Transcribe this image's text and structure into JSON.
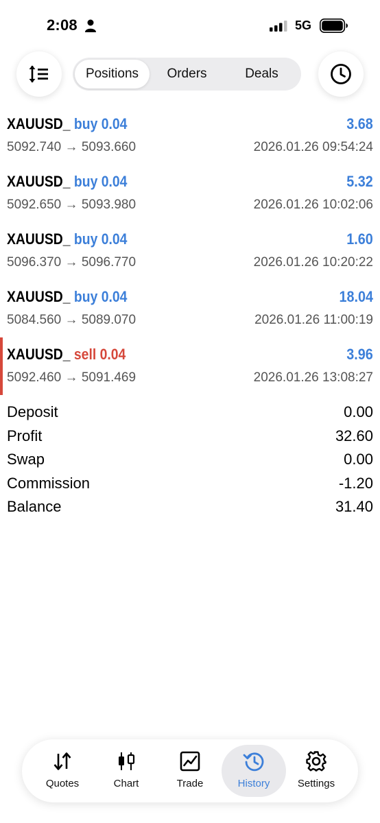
{
  "status": {
    "time": "2:08",
    "network": "5G"
  },
  "toolbar": {
    "tabs": [
      "Positions",
      "Orders",
      "Deals"
    ],
    "active_tab": "Positions"
  },
  "trades": [
    {
      "symbol": "XAUUSD_",
      "side": "buy",
      "volume": "0.04",
      "profit": "3.68",
      "open": "5092.740",
      "close": "5093.660",
      "time": "2026.01.26 09:54:24"
    },
    {
      "symbol": "XAUUSD_",
      "side": "buy",
      "volume": "0.04",
      "profit": "5.32",
      "open": "5092.650",
      "close": "5093.980",
      "time": "2026.01.26 10:02:06"
    },
    {
      "symbol": "XAUUSD_",
      "side": "buy",
      "volume": "0.04",
      "profit": "1.60",
      "open": "5096.370",
      "close": "5096.770",
      "time": "2026.01.26 10:20:22"
    },
    {
      "symbol": "XAUUSD_",
      "side": "buy",
      "volume": "0.04",
      "profit": "18.04",
      "open": "5084.560",
      "close": "5089.070",
      "time": "2026.01.26 11:00:19"
    },
    {
      "symbol": "XAUUSD_",
      "side": "sell",
      "volume": "0.04",
      "profit": "3.96",
      "open": "5092.460",
      "close": "5091.469",
      "time": "2026.01.26 13:08:27"
    }
  ],
  "summary": [
    {
      "label": "Deposit",
      "value": "0.00"
    },
    {
      "label": "Profit",
      "value": "32.60"
    },
    {
      "label": "Swap",
      "value": "0.00"
    },
    {
      "label": "Commission",
      "value": "-1.20"
    },
    {
      "label": "Balance",
      "value": "31.40"
    }
  ],
  "tabbar": [
    {
      "label": "Quotes",
      "icon": "quotes-arrows-icon"
    },
    {
      "label": "Chart",
      "icon": "candlestick-icon"
    },
    {
      "label": "Trade",
      "icon": "trade-chart-icon"
    },
    {
      "label": "History",
      "icon": "history-icon",
      "active": true
    },
    {
      "label": "Settings",
      "icon": "gear-icon"
    }
  ],
  "colors": {
    "accent": "#3c7fd9",
    "sell": "#d6483b"
  }
}
